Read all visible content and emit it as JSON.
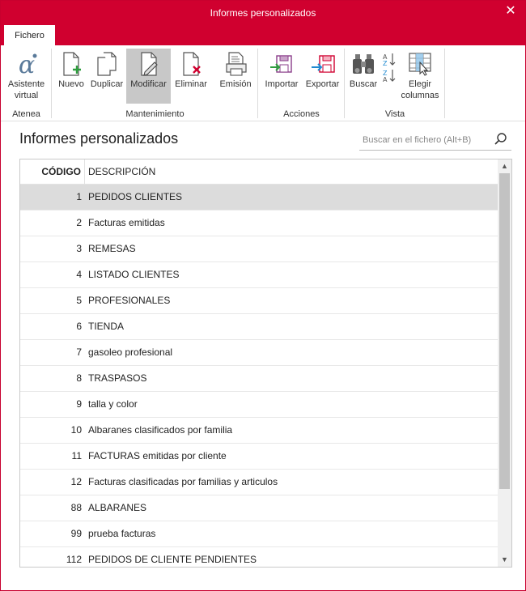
{
  "window": {
    "title": "Informes personalizados",
    "close_glyph": "✕"
  },
  "tabs": [
    {
      "label": "Fichero",
      "active": true
    }
  ],
  "ribbon": {
    "groups": [
      {
        "label": "Atenea",
        "buttons": [
          {
            "label1": "Asistente",
            "label2": "virtual",
            "icon": "alpha-icon"
          }
        ]
      },
      {
        "label": "Mantenimiento",
        "buttons": [
          {
            "label1": "Nuevo",
            "icon": "new-document-icon"
          },
          {
            "label1": "Duplicar",
            "icon": "duplicate-icon"
          },
          {
            "label1": "Modificar",
            "icon": "edit-document-icon",
            "active": true
          },
          {
            "label1": "Eliminar",
            "icon": "delete-document-icon"
          },
          {
            "label1": "Emisión",
            "icon": "print-icon"
          }
        ]
      },
      {
        "label": "Acciones",
        "buttons": [
          {
            "label1": "Importar",
            "icon": "import-icon"
          },
          {
            "label1": "Exportar",
            "icon": "export-icon"
          }
        ]
      },
      {
        "label": "Vista",
        "buttons": [
          {
            "label1": "Buscar",
            "icon": "binoculars-icon"
          },
          {
            "label1": "",
            "icon": "sort-az-icon"
          },
          {
            "label1": "Elegir",
            "label2": "columnas",
            "icon": "choose-columns-icon"
          }
        ]
      }
    ]
  },
  "page": {
    "title": "Informes personalizados"
  },
  "search": {
    "placeholder": "Buscar en el fichero (Alt+B)"
  },
  "table": {
    "columns": [
      "CÓDIGO",
      "DESCRIPCIÓN"
    ],
    "rows": [
      {
        "code": "1",
        "desc": "PEDIDOS CLIENTES",
        "selected": true
      },
      {
        "code": "2",
        "desc": "Facturas emitidas"
      },
      {
        "code": "3",
        "desc": "REMESAS"
      },
      {
        "code": "4",
        "desc": "LISTADO CLIENTES"
      },
      {
        "code": "5",
        "desc": "PROFESIONALES"
      },
      {
        "code": "6",
        "desc": "TIENDA"
      },
      {
        "code": "7",
        "desc": "gasoleo profesional"
      },
      {
        "code": "8",
        "desc": "TRASPASOS"
      },
      {
        "code": "9",
        "desc": "talla y color"
      },
      {
        "code": "10",
        "desc": "Albaranes clasificados por familia"
      },
      {
        "code": "11",
        "desc": "FACTURAS emitidas por cliente"
      },
      {
        "code": "12",
        "desc": "Facturas clasificadas por familias y articulos"
      },
      {
        "code": "88",
        "desc": "ALBARANES"
      },
      {
        "code": "99",
        "desc": "prueba facturas"
      },
      {
        "code": "112",
        "desc": "PEDIDOS DE CLIENTE PENDIENTES"
      }
    ]
  },
  "colors": {
    "accent": "#d0002f",
    "selected_row": "#dcdcdc",
    "active_button": "#c8c8c8"
  }
}
